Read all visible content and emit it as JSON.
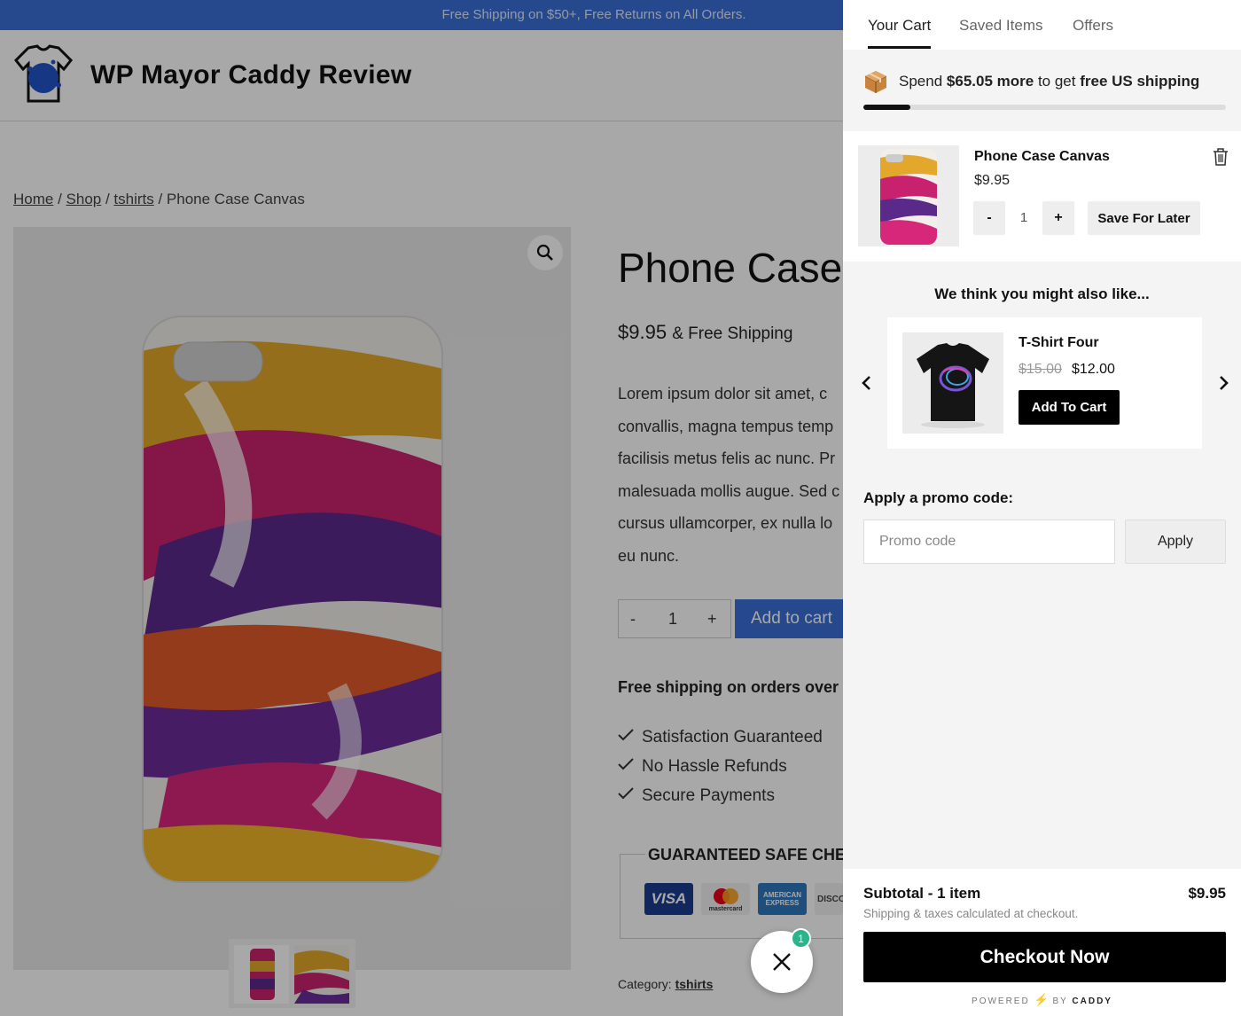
{
  "store": {
    "announcement": "Free Shipping on $50+, Free Returns on All Orders.",
    "site_title": "WP Mayor Caddy Review",
    "breadcrumb": {
      "home": "Home",
      "shop": "Shop",
      "category": "tshirts",
      "current": "Phone Case Canvas",
      "sep": " / "
    },
    "product": {
      "title": "Phone Case",
      "price": "$9.95",
      "shipping_note": "& Free Shipping",
      "description": [
        "Lorem ipsum dolor sit amet, c",
        "convallis, magna tempus temp",
        "facilisis metus felis ac nunc. Pr",
        "malesuada mollis augue. Sed c",
        "cursus ullamcorper, ex nulla lo",
        "eu nunc."
      ],
      "qty_minus": "-",
      "qty_value": "1",
      "qty_plus": "+",
      "add_to_cart": "Add to cart",
      "free_shipping_heading": "Free shipping on orders over",
      "features": [
        "Satisfaction Guaranteed",
        "No Hassle Refunds",
        "Secure Payments"
      ],
      "guarantee_title": "GUARANTEED SAFE CHEC",
      "payment_cards": [
        "VISA",
        "mastercard",
        "AMERICAN EXPRESS",
        "DISCO"
      ],
      "category_label": "Category:",
      "category_value": "tshirts"
    },
    "fab_badge": "1"
  },
  "cart": {
    "tabs": [
      "Your Cart",
      "Saved Items",
      "Offers"
    ],
    "shipping": {
      "prefix": "Spend",
      "amount": "$65.05 more",
      "middle": "to get",
      "goal": "free US shipping",
      "progress": 0.13
    },
    "item": {
      "name": "Phone Case Canvas",
      "price": "$9.95",
      "minus": "-",
      "qty": "1",
      "plus": "+",
      "save_later": "Save For Later"
    },
    "recommend": {
      "heading": "We think you might also like...",
      "name": "T-Shirt Four",
      "old_price": "$15.00",
      "new_price": "$12.00",
      "button": "Add To Cart"
    },
    "promo": {
      "label": "Apply a promo code:",
      "placeholder": "Promo code",
      "button": "Apply"
    },
    "footer": {
      "subtotal_label": "Subtotal - 1 item",
      "subtotal_amount": "$9.95",
      "note": "Shipping & taxes calculated at checkout.",
      "checkout": "Checkout Now",
      "powered_by": "POWERED",
      "by": "BY",
      "brand": "CADDY"
    }
  },
  "colors": {
    "accent_blue": "#3a6fd6",
    "badge_green": "#2bb38a",
    "checkout_black": "#000000"
  }
}
